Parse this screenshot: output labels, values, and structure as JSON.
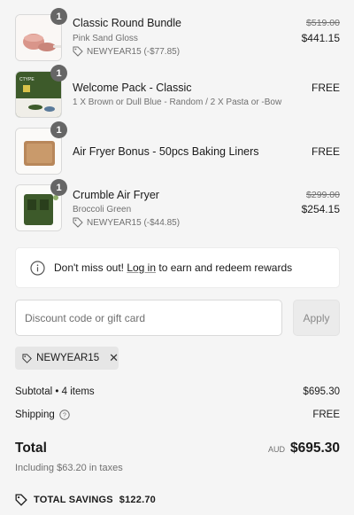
{
  "items": [
    {
      "qty": "1",
      "name": "Classic Round Bundle",
      "variant": "Pink Sand Gloss",
      "discount": "NEWYEAR15 (-$77.85)",
      "original_price": "$519.00",
      "price": "$441.15"
    },
    {
      "qty": "1",
      "name": "Welcome Pack - Classic",
      "variant": "1 X Brown or Dull Blue - Random / 2 X Pasta or -Bow",
      "price": "FREE",
      "thumb_text": "CTYPE"
    },
    {
      "qty": "1",
      "name": "Air Fryer Bonus - 50pcs Baking Liners",
      "price": "FREE"
    },
    {
      "qty": "1",
      "name": "Crumble Air Fryer",
      "variant": "Broccoli Green",
      "discount": "NEWYEAR15 (-$44.85)",
      "original_price": "$299.00",
      "price": "$254.15"
    }
  ],
  "notice": {
    "before": "Don't miss out! ",
    "link": "Log in",
    "after": " to earn and redeem rewards"
  },
  "discount": {
    "placeholder": "Discount code or gift card",
    "apply_label": "Apply",
    "applied_code": "NEWYEAR15"
  },
  "summary": {
    "subtotal_label": "Subtotal • 4 items",
    "subtotal_value": "$695.30",
    "shipping_label": "Shipping",
    "shipping_value": "FREE",
    "total_label": "Total",
    "currency": "AUD",
    "total_value": "$695.30",
    "taxes": "Including $63.20 in taxes",
    "savings_label": "TOTAL SAVINGS",
    "savings_value": "$122.70"
  },
  "colors": {
    "badge": "#666666",
    "background": "#f5f5f5",
    "thumb_green": "#3d5a2a"
  }
}
